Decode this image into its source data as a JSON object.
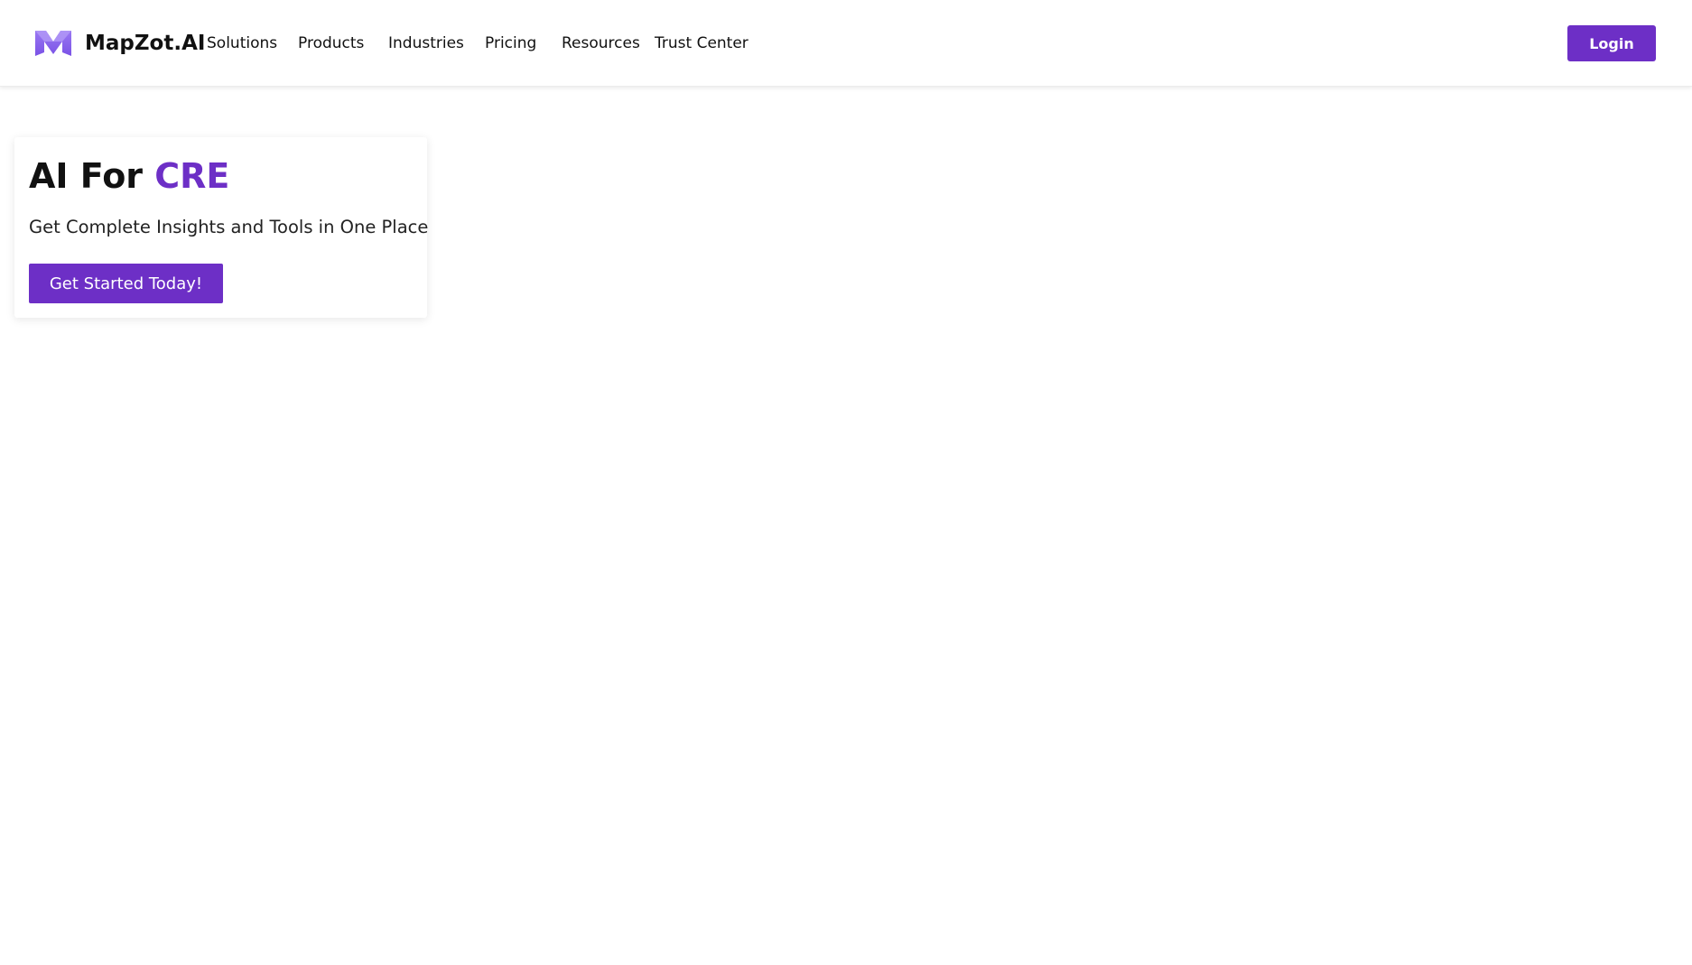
{
  "brand": {
    "name": "MapZot.AI",
    "logo_icon": "m-logo-icon"
  },
  "nav": {
    "items": [
      {
        "label": "Solutions"
      },
      {
        "label": "Products"
      },
      {
        "label": "Industries"
      },
      {
        "label": "Pricing"
      },
      {
        "label": "Resources"
      },
      {
        "label": "Trust Center"
      }
    ]
  },
  "header": {
    "login_label": "Login"
  },
  "hero": {
    "title_prefix": "AI For ",
    "title_accent": "CRE",
    "subtitle": "Get Complete Insights and Tools in One Place",
    "cta_label": "Get Started Today!"
  },
  "colors": {
    "accent": "#6d2fc6",
    "logo_light": "#a58af5",
    "logo_dark": "#7e57e8"
  }
}
